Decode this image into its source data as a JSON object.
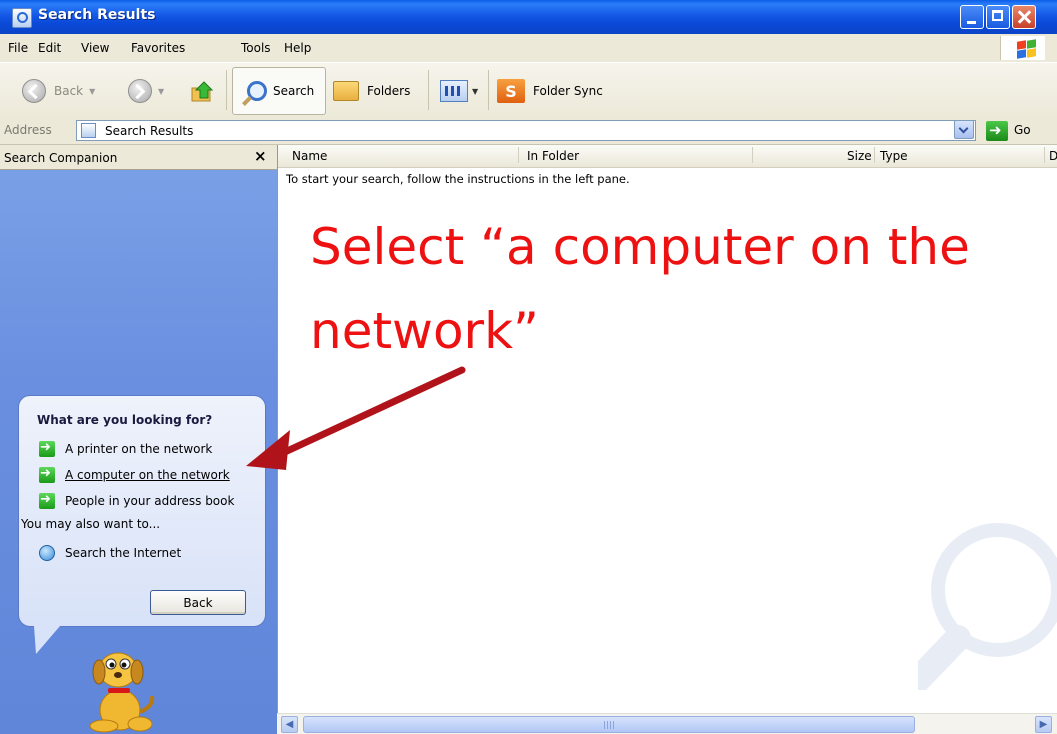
{
  "window": {
    "title": "Search Results"
  },
  "menubar": {
    "items": [
      "File",
      "Edit",
      "View",
      "Favorites",
      "Tools",
      "Help"
    ]
  },
  "toolbar": {
    "back_label": "Back",
    "search_label": "Search",
    "folders_label": "Folders",
    "folder_sync_label": "Folder Sync",
    "folder_sync_icon_letter": "S"
  },
  "address": {
    "label": "Address",
    "value": "Search Results",
    "go_label": "Go"
  },
  "search_companion": {
    "title": "Search Companion",
    "close_glyph": "×",
    "question": "What are you looking for?",
    "options": [
      "A printer on the network",
      "A computer on the network",
      "People in your address book"
    ],
    "also_label": "You may also want to...",
    "search_internet_label": "Search the Internet",
    "back_button": "Back"
  },
  "results": {
    "columns": [
      "Name",
      "In Folder",
      "Size",
      "Type",
      "D"
    ],
    "instruction": "To start your search, follow the instructions in the left pane."
  },
  "annotation": {
    "text_line1": "Select “a computer on the",
    "text_line2": "network”",
    "color": "#ee1111",
    "arrow_color": "#b0141a"
  }
}
